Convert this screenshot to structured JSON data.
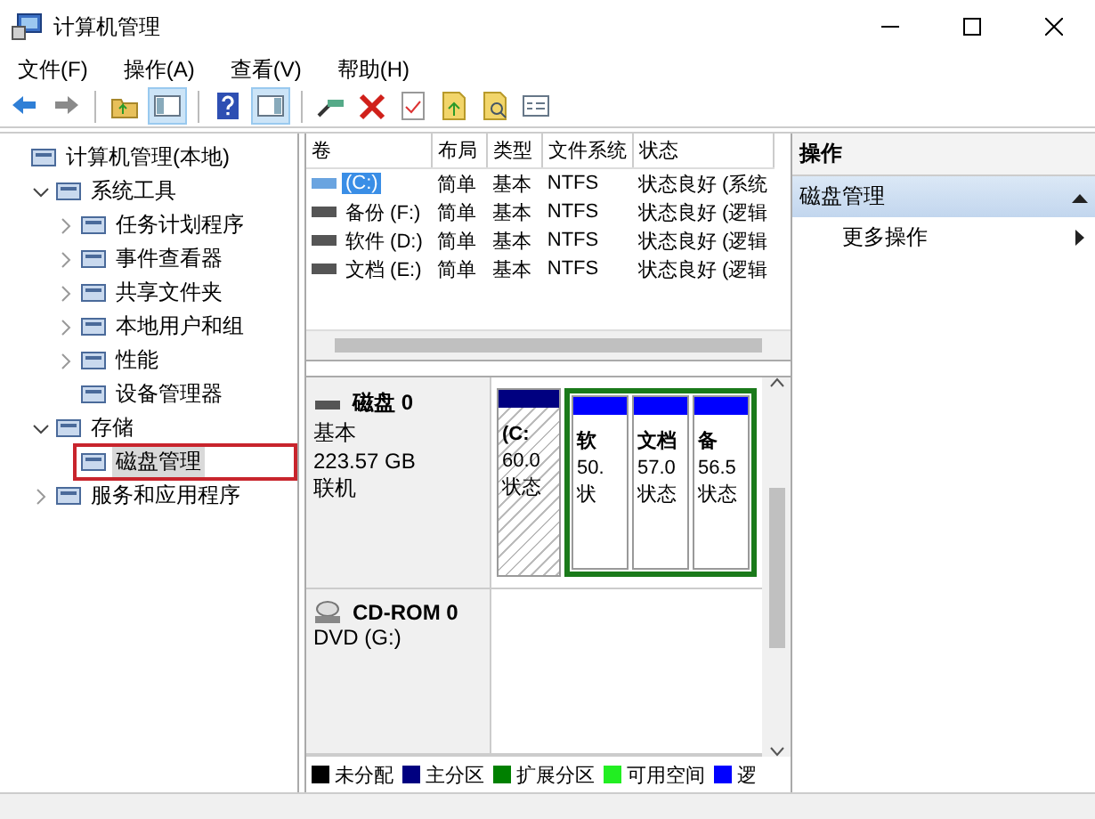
{
  "window": {
    "title": "计算机管理"
  },
  "menu": [
    "文件(F)",
    "操作(A)",
    "查看(V)",
    "帮助(H)"
  ],
  "tree": [
    {
      "label": "计算机管理(本地)",
      "selected": false,
      "children": [
        {
          "label": "系统工具",
          "expanded": true,
          "selected": false,
          "children": [
            {
              "label": "任务计划程序",
              "expanded": false,
              "selected": false
            },
            {
              "label": "事件查看器",
              "expanded": false,
              "selected": false
            },
            {
              "label": "共享文件夹",
              "expanded": false,
              "selected": false
            },
            {
              "label": "本地用户和组",
              "expanded": false,
              "selected": false
            },
            {
              "label": "性能",
              "expanded": false,
              "selected": false
            },
            {
              "label": "设备管理器",
              "selected": false
            }
          ]
        },
        {
          "label": "存储",
          "expanded": true,
          "selected": false,
          "children": [
            {
              "label": "磁盘管理",
              "selected": true,
              "highlight_box": true
            }
          ]
        },
        {
          "label": "服务和应用程序",
          "expanded": false,
          "selected": false
        }
      ]
    }
  ],
  "volumes": {
    "columns": [
      "卷",
      "布局",
      "类型",
      "文件系统",
      "状态"
    ],
    "rows": [
      {
        "selected": true,
        "cells": [
          "(C:)",
          "简单",
          "基本",
          "NTFS",
          "状态良好 (系统"
        ]
      },
      {
        "selected": false,
        "cells": [
          "备份 (F:)",
          "简单",
          "基本",
          "NTFS",
          "状态良好 (逻辑"
        ]
      },
      {
        "selected": false,
        "cells": [
          "软件 (D:)",
          "简单",
          "基本",
          "NTFS",
          "状态良好 (逻辑"
        ]
      },
      {
        "selected": false,
        "cells": [
          "文档 (E:)",
          "简单",
          "基本",
          "NTFS",
          "状态良好 (逻辑"
        ]
      }
    ]
  },
  "disks": [
    {
      "kind": "disk",
      "name": "磁盘 0",
      "lines": [
        "基本",
        "223.57 GB",
        "联机"
      ],
      "partitions": [
        {
          "kind": "primary",
          "selected": true,
          "lines": [
            "(C:",
            "60.0",
            "状态"
          ]
        },
        {
          "kind": "extended",
          "children": [
            {
              "kind": "logical",
              "selected": false,
              "lines": [
                "软",
                "50.",
                "状"
              ]
            },
            {
              "kind": "logical",
              "selected": false,
              "lines": [
                "文档",
                "57.0",
                "状态"
              ]
            },
            {
              "kind": "logical",
              "selected": false,
              "lines": [
                "备",
                "56.5",
                "状态"
              ]
            }
          ]
        }
      ]
    },
    {
      "kind": "cdrom",
      "name": "CD-ROM 0",
      "lines": [
        "DVD (G:)"
      ]
    }
  ],
  "legend": [
    {
      "label": "未分配",
      "color": "#000000"
    },
    {
      "label": "主分区",
      "color": "#000080"
    },
    {
      "label": "扩展分区",
      "color": "#008000"
    },
    {
      "label": "可用空间",
      "color": "#22ee22"
    },
    {
      "label": "逻",
      "color": "#0000ff"
    }
  ],
  "actions": {
    "title": "操作",
    "sections": [
      {
        "label": "磁盘管理",
        "expanded": true,
        "items": [
          "更多操作"
        ]
      }
    ]
  }
}
